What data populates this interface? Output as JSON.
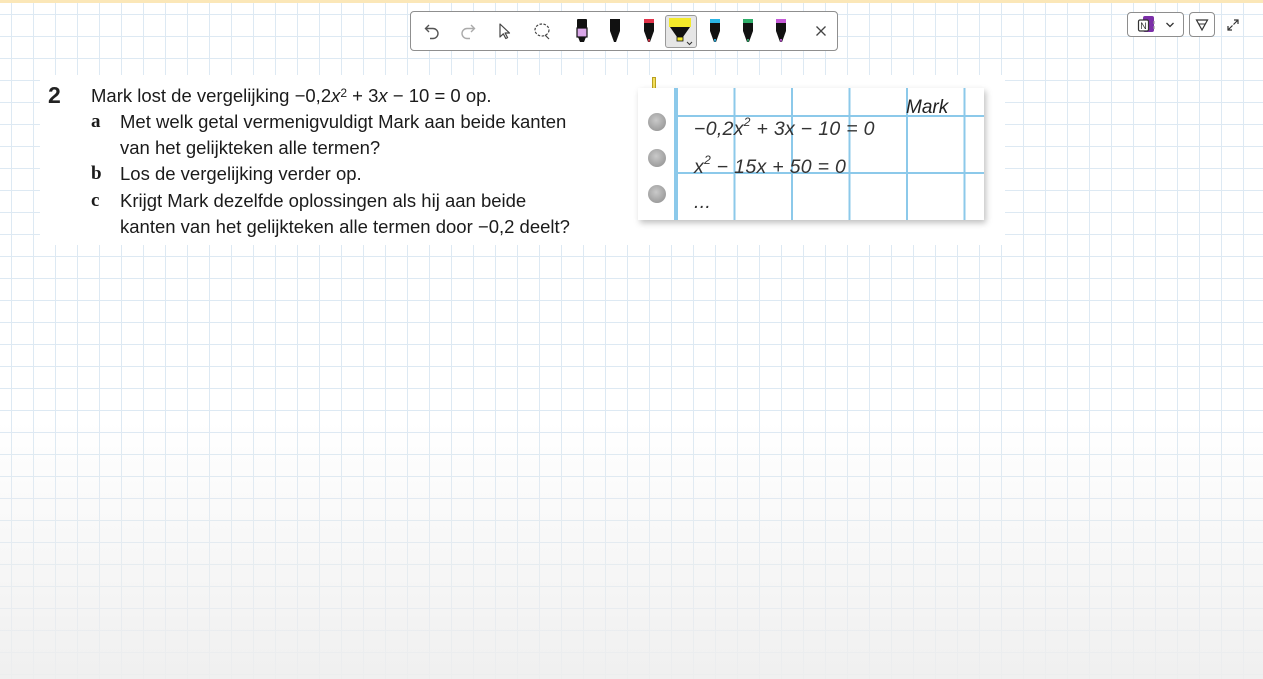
{
  "toolbar": {
    "tools": [
      "undo-icon",
      "redo-icon",
      "select-icon",
      "lasso-icon"
    ],
    "pens": [
      {
        "name": "pen-black-lilac",
        "color": "#111111",
        "accent": "#d9a6e8"
      },
      {
        "name": "pen-black",
        "color": "#111111",
        "accent": "#111111"
      },
      {
        "name": "pen-red",
        "color": "#111111",
        "accent": "#e2344b"
      },
      {
        "name": "highlighter-yellow",
        "color": "#111111",
        "accent": "#f4ea2a",
        "selected": true
      },
      {
        "name": "pen-blue",
        "color": "#111111",
        "accent": "#2bb5e6"
      },
      {
        "name": "pen-green",
        "color": "#111111",
        "accent": "#2fae6a"
      },
      {
        "name": "pen-purple",
        "color": "#111111",
        "accent": "#c55ad8"
      }
    ],
    "close_icon": "close-icon"
  },
  "right_controls": {
    "app_icon": "onenote-icon",
    "dropdown_icon": "chevron-down-icon",
    "filter_icon": "filter-icon",
    "expand_icon": "expand-icon"
  },
  "exercise": {
    "number": "2",
    "intro": {
      "before": "Mark lost de vergelijking −0,2",
      "var": "x",
      "exp": "2",
      "after_plus": " + 3",
      "var2": "x",
      "after": " − 10 = 0 op."
    },
    "parts": [
      {
        "letter": "a",
        "lines": [
          "Met welk getal vermenigvuldigt Mark aan beide kanten",
          "van het gelijkteken alle termen?"
        ]
      },
      {
        "letter": "b",
        "lines": [
          "Los de vergelijking verder op."
        ]
      },
      {
        "letter": "c",
        "lines": [
          "Krijgt Mark dezelfde oplossingen als hij aan beide",
          "kanten van het gelijkteken alle termen door −0,2 deelt?"
        ]
      }
    ]
  },
  "notebook": {
    "name": "Mark",
    "eq1": {
      "a": "−0,2",
      "x": "x",
      "exp": "2",
      "rest": " + 3x − 10 = 0"
    },
    "eq2": {
      "x": "x",
      "exp": "2",
      "rest": " − 15x + 50 = 0"
    },
    "eq3": "..."
  }
}
